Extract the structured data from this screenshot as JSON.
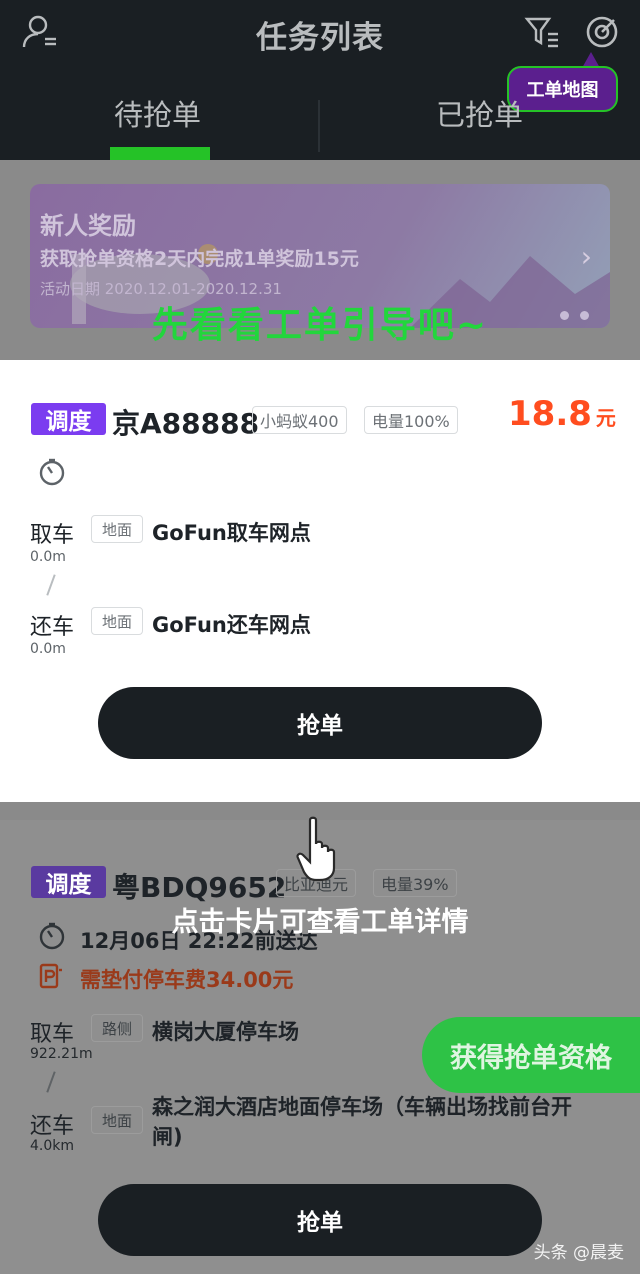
{
  "header": {
    "title": "任务列表",
    "tabs": [
      {
        "label": "待抢单"
      },
      {
        "label": "已抢单"
      }
    ],
    "map_tooltip": "工单地图"
  },
  "banner": {
    "title": "新人奖励",
    "desc": "获取抢单资格2天内完成1单奖励15元",
    "period": "活动日期 2020.12.01-2020.12.31"
  },
  "guide_text": "先看看工单引导吧~",
  "card1": {
    "tag": "调度",
    "plate": "京A88888",
    "model": "小蚂蚁400",
    "battery": "电量100%",
    "price": "18.8",
    "price_unit": "元",
    "pickup": {
      "label": "取车",
      "distance": "0.0m",
      "type": "地面",
      "name": "GoFun取车网点"
    },
    "return": {
      "label": "还车",
      "distance": "0.0m",
      "type": "地面",
      "name": "GoFun还车网点"
    },
    "button": "抢单"
  },
  "tap_hint": "点击卡片可查看工单详情",
  "card2": {
    "tag": "调度",
    "plate": "粤BDQ9652",
    "model": "比亚迪元",
    "battery": "电量39%",
    "deadline": "12月06日 22:22前送达",
    "parking_fee": "需垫付停车费34.00元",
    "pickup": {
      "label": "取车",
      "distance": "922.21m",
      "type": "路侧",
      "name": "横岗大厦停车场"
    },
    "return": {
      "label": "还车",
      "distance": "4.0km",
      "type": "地面",
      "name": "森之润大酒店地面停车场（车辆出场找前台开闸)"
    },
    "button": "抢单"
  },
  "qualify_button": "获得抢单资格",
  "watermark": "头条 @晨麦",
  "colors": {
    "accent_green": "#25c227",
    "tag_purple": "#7b3cf0",
    "price_orange": "#ff4d1f",
    "header_bg": "#1a1f23"
  }
}
